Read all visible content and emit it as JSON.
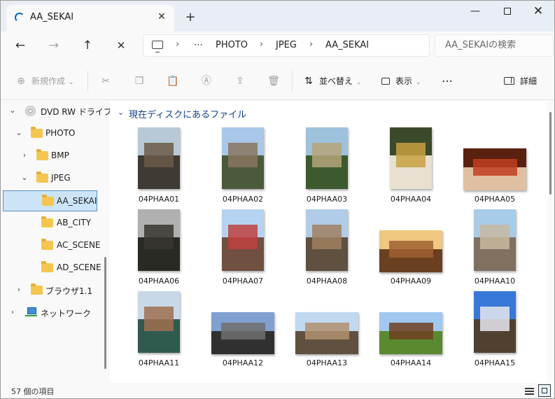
{
  "tab": {
    "title": "AA_SEKAI",
    "close": "✕",
    "add": "+"
  },
  "window_controls": {
    "minimize": "—",
    "close": "✕"
  },
  "nav": {
    "back": "←",
    "forward": "→",
    "up": "↑",
    "stop": "✕"
  },
  "breadcrumb": {
    "ellipsis": "⋯",
    "sep": "›",
    "items": [
      "PHOTO",
      "JPEG",
      "AA_SEKAI"
    ]
  },
  "search": {
    "placeholder": "AA_SEKAIの検索"
  },
  "command_bar": {
    "new": "新規作成",
    "sort": "並べ替え",
    "view": "表示",
    "more": "⋯",
    "details": "詳細",
    "icons": {
      "cut": "✂",
      "copy": "❐",
      "paste": "📋",
      "rename": "Ⓐ",
      "share": "⇪",
      "delete": "🗑",
      "new": "⊕",
      "sort": "⇅",
      "chevron": "⌄"
    }
  },
  "sidebar": {
    "chevron_expanded": "⌄",
    "chevron_collapsed": "›",
    "items": [
      {
        "label": "DVD RW ドライブ",
        "icon": "disc-icon"
      },
      {
        "label": "PHOTO",
        "icon": "folder-icon"
      },
      {
        "label": "BMP",
        "icon": "folder-icon"
      },
      {
        "label": "JPEG",
        "icon": "folder-icon"
      },
      {
        "label": "AA_SEKAI",
        "icon": "folder-icon",
        "selected": true
      },
      {
        "label": "AB_CITY",
        "icon": "folder-icon"
      },
      {
        "label": "AC_SCENE",
        "icon": "folder-icon"
      },
      {
        "label": "AD_SCENE",
        "icon": "folder-icon"
      },
      {
        "label": "ブラウザ1.1",
        "icon": "folder-icon"
      },
      {
        "label": "ネットワーク",
        "icon": "network-icon"
      }
    ]
  },
  "content": {
    "group_chevron": "⌄",
    "group_title": "現在ディスクにあるファイル",
    "files": [
      {
        "name": "04PHAA01",
        "colors": [
          "#b7c9d6",
          "#6b5a48",
          "#3f3a33"
        ]
      },
      {
        "name": "04PHAA02",
        "colors": [
          "#a9c7e8",
          "#8a7560",
          "#4b5a3a"
        ]
      },
      {
        "name": "04PHAA03",
        "colors": [
          "#9ec1dc",
          "#b5a57a",
          "#3d5a2e"
        ]
      },
      {
        "name": "04PHAA04",
        "colors": [
          "#3a4a2a",
          "#c8a040",
          "#e8e0d0"
        ]
      },
      {
        "name": "04PHAA05",
        "colors": [
          "#5a2010",
          "#c04020",
          "#e0c0a0"
        ]
      },
      {
        "name": "04PHAA06",
        "colors": [
          "#b0b0b0",
          "#3a3530",
          "#2a2a25"
        ]
      },
      {
        "name": "04PHAA07",
        "colors": [
          "#b5d3f0",
          "#c04040",
          "#705040"
        ]
      },
      {
        "name": "04PHAA08",
        "colors": [
          "#b0cce8",
          "#a08060",
          "#605040"
        ]
      },
      {
        "name": "04PHAA09",
        "colors": [
          "#f0c880",
          "#a06030",
          "#6a4020"
        ]
      },
      {
        "name": "04PHAA10",
        "colors": [
          "#a8cbe8",
          "#c8b8a0",
          "#807060"
        ]
      },
      {
        "name": "04PHAA11",
        "colors": [
          "#c8d8e8",
          "#a07050",
          "#305a50"
        ]
      },
      {
        "name": "04PHAA12",
        "colors": [
          "#80a0d0",
          "#707070",
          "#303030"
        ]
      },
      {
        "name": "04PHAA13",
        "colors": [
          "#c0d8f0",
          "#b09070",
          "#605040"
        ]
      },
      {
        "name": "04PHAA14",
        "colors": [
          "#a0c8f0",
          "#704020",
          "#5a8a30"
        ]
      },
      {
        "name": "04PHAA15",
        "colors": [
          "#3878d8",
          "#e8e8f0",
          "#504030"
        ]
      }
    ]
  },
  "status": {
    "item_count": "57 個の項目"
  }
}
